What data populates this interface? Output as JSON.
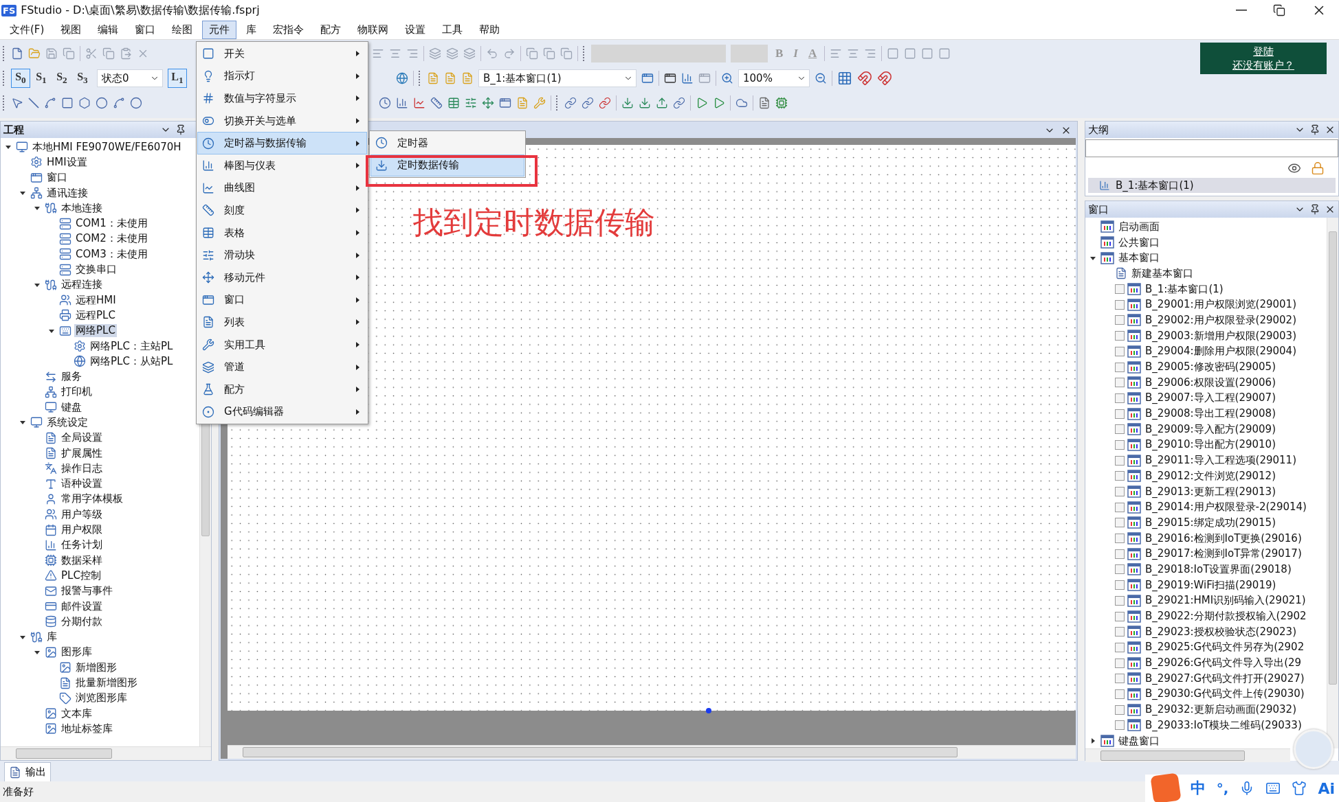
{
  "window": {
    "badge": "FS",
    "title": "FStudio - D:\\桌面\\繁易\\数据传输\\数据传输.fsprj"
  },
  "menu_bar": [
    {
      "label": "文件(F)",
      "selected": false
    },
    {
      "label": "视图",
      "selected": false
    },
    {
      "label": "编辑",
      "selected": false
    },
    {
      "label": "窗口",
      "selected": false
    },
    {
      "label": "绘图",
      "selected": false
    },
    {
      "label": "元件",
      "selected": true
    },
    {
      "label": "库",
      "selected": false
    },
    {
      "label": "宏指令",
      "selected": false
    },
    {
      "label": "配方",
      "selected": false
    },
    {
      "label": "物联网",
      "selected": false
    },
    {
      "label": "设置",
      "selected": false
    },
    {
      "label": "工具",
      "selected": false
    },
    {
      "label": "帮助",
      "selected": false
    }
  ],
  "toolbar": {
    "state_buttons": [
      {
        "label": "S$_{0}$",
        "selected": true
      },
      {
        "label": "S$_{1}$",
        "selected": false
      },
      {
        "label": "S$_{2}$",
        "selected": false
      },
      {
        "label": "S$_{3}$",
        "selected": false
      }
    ],
    "state_select": "状态0",
    "layer_button": "L$_{1}$",
    "window_select": "B_1:基本窗口(1)",
    "zoom_select": "100%",
    "format_buttons": [
      "B",
      "I",
      "A"
    ]
  },
  "login": {
    "title": "登陆",
    "subtitle": "还没有账户？"
  },
  "component_menu": {
    "items": [
      {
        "label": "开关",
        "selected": false
      },
      {
        "label": "指示灯",
        "selected": false
      },
      {
        "label": "数值与字符显示",
        "selected": false
      },
      {
        "label": "切换开关与选单",
        "selected": false
      },
      {
        "label": "定时器与数据传输",
        "selected": true
      },
      {
        "label": "棒图与仪表",
        "selected": false
      },
      {
        "label": "曲线图",
        "selected": false
      },
      {
        "label": "刻度",
        "selected": false
      },
      {
        "label": "表格",
        "selected": false
      },
      {
        "label": "滑动块",
        "selected": false
      },
      {
        "label": "移动元件",
        "selected": false
      },
      {
        "label": "窗口",
        "selected": false
      },
      {
        "label": "列表",
        "selected": false
      },
      {
        "label": "实用工具",
        "selected": false
      },
      {
        "label": "管道",
        "selected": false
      },
      {
        "label": "配方",
        "selected": false
      },
      {
        "label": "G代码编辑器",
        "selected": false
      }
    ],
    "submenu": [
      {
        "label": "定时器",
        "selected": false
      },
      {
        "label": "定时数据传输",
        "selected": true
      }
    ]
  },
  "annotation": "找到定时数据传输",
  "project_panel": {
    "title": "工程",
    "tree": [
      {
        "label": "本地HMI FE9070WE/FE6070H",
        "selected": false,
        "expanded": true,
        "children": [
          {
            "label": "HMI设置",
            "selected": false
          },
          {
            "label": "窗口",
            "selected": false
          },
          {
            "label": "通讯连接",
            "selected": false,
            "expanded": true,
            "children": [
              {
                "label": "本地连接",
                "selected": false,
                "expanded": true,
                "children": [
                  {
                    "label": "COM1：未使用",
                    "selected": false
                  },
                  {
                    "label": "COM2：未使用",
                    "selected": false
                  },
                  {
                    "label": "COM3：未使用",
                    "selected": false
                  },
                  {
                    "label": "交换串口",
                    "selected": false
                  }
                ]
              },
              {
                "label": "远程连接",
                "selected": false,
                "expanded": true,
                "children": [
                  {
                    "label": "远程HMI",
                    "selected": false
                  },
                  {
                    "label": "远程PLC",
                    "selected": false
                  },
                  {
                    "label": "网络PLC",
                    "selected": true,
                    "expanded": true,
                    "children": [
                      {
                        "label": "网络PLC：主站PL",
                        "selected": false
                      },
                      {
                        "label": "网络PLC：从站PL",
                        "selected": false
                      }
                    ]
                  }
                ]
              },
              {
                "label": "服务",
                "selected": false
              },
              {
                "label": "打印机",
                "selected": false
              },
              {
                "label": "键盘",
                "selected": false
              }
            ]
          },
          {
            "label": "系统设定",
            "selected": false,
            "expanded": true,
            "children": [
              {
                "label": "全局设置",
                "selected": false
              },
              {
                "label": "扩展属性",
                "selected": false
              },
              {
                "label": "操作日志",
                "selected": false
              },
              {
                "label": "语种设置",
                "selected": false
              },
              {
                "label": "常用字体模板",
                "selected": false
              },
              {
                "label": "用户等级",
                "selected": false
              },
              {
                "label": "用户权限",
                "selected": false
              },
              {
                "label": "任务计划",
                "selected": false
              },
              {
                "label": "数据采样",
                "selected": false
              },
              {
                "label": "PLC控制",
                "selected": false
              },
              {
                "label": "报警与事件",
                "selected": false
              },
              {
                "label": "邮件设置",
                "selected": false
              },
              {
                "label": "分期付款",
                "selected": false
              }
            ]
          },
          {
            "label": "库",
            "selected": false,
            "expanded": true,
            "children": [
              {
                "label": "图形库",
                "selected": false,
                "expanded": true,
                "children": [
                  {
                    "label": "新增图形",
                    "selected": false
                  },
                  {
                    "label": "批量新增图形",
                    "selected": false
                  },
                  {
                    "label": "浏览图形库",
                    "selected": false
                  }
                ]
              },
              {
                "label": "文本库",
                "selected": false
              },
              {
                "label": "地址标签库",
                "selected": false
              }
            ]
          }
        ]
      }
    ]
  },
  "outline_panel": {
    "title": "大纲",
    "row": "B_1:基本窗口(1)"
  },
  "window_panel": {
    "title": "窗口",
    "tree": [
      {
        "label": "启动画面",
        "kind": "folder"
      },
      {
        "label": "公共窗口",
        "kind": "folder"
      },
      {
        "label": "基本窗口",
        "kind": "folder",
        "expanded": true,
        "children": [
          {
            "label": "新建基本窗口",
            "kind": "action"
          },
          {
            "label": "B_1:基本窗口(1)",
            "kind": "page",
            "checked": false
          },
          {
            "label": "B_29001:用户权限浏览(29001)",
            "kind": "page",
            "checked": false
          },
          {
            "label": "B_29002:用户权限登录(29002)",
            "kind": "page",
            "checked": false
          },
          {
            "label": "B_29003:新增用户权限(29003)",
            "kind": "page",
            "checked": false
          },
          {
            "label": "B_29004:删除用户权限(29004)",
            "kind": "page",
            "checked": false
          },
          {
            "label": "B_29005:修改密码(29005)",
            "kind": "page",
            "checked": false
          },
          {
            "label": "B_29006:权限设置(29006)",
            "kind": "page",
            "checked": false
          },
          {
            "label": "B_29007:导入工程(29007)",
            "kind": "page",
            "checked": false
          },
          {
            "label": "B_29008:导出工程(29008)",
            "kind": "page",
            "checked": false
          },
          {
            "label": "B_29009:导入配方(29009)",
            "kind": "page",
            "checked": false
          },
          {
            "label": "B_29010:导出配方(29010)",
            "kind": "page",
            "checked": false
          },
          {
            "label": "B_29011:导入工程选项(29011)",
            "kind": "page",
            "checked": false
          },
          {
            "label": "B_29012:文件浏览(29012)",
            "kind": "page",
            "checked": false
          },
          {
            "label": "B_29013:更新工程(29013)",
            "kind": "page",
            "checked": false
          },
          {
            "label": "B_29014:用户权限登录-2(29014)",
            "kind": "page",
            "checked": false
          },
          {
            "label": "B_29015:绑定成功(29015)",
            "kind": "page",
            "checked": false
          },
          {
            "label": "B_29016:检测到IoT更换(29016)",
            "kind": "page",
            "checked": false
          },
          {
            "label": "B_29017:检测到IoT异常(29017)",
            "kind": "page",
            "checked": false
          },
          {
            "label": "B_29018:IoT设置界面(29018)",
            "kind": "page",
            "checked": false
          },
          {
            "label": "B_29019:WiFi扫描(29019)",
            "kind": "page",
            "checked": false
          },
          {
            "label": "B_29021:HMI识别码输入(29021)",
            "kind": "page",
            "checked": false
          },
          {
            "label": "B_29022:分期付款授权输入(2902",
            "kind": "page",
            "checked": false
          },
          {
            "label": "B_29023:授权校验状态(29023)",
            "kind": "page",
            "checked": false
          },
          {
            "label": "B_29025:G代码文件另存为(2902",
            "kind": "page",
            "checked": false
          },
          {
            "label": "B_29026:G代码文件导入导出(29",
            "kind": "page",
            "checked": false
          },
          {
            "label": "B_29027:G代码文件打开(29027)",
            "kind": "page",
            "checked": false
          },
          {
            "label": "B_29030:G代码文件上传(29030)",
            "kind": "page",
            "checked": false
          },
          {
            "label": "B_29032:更新启动画面(29032)",
            "kind": "page",
            "checked": false
          },
          {
            "label": "B_29033:IoT模块二维码(29033)",
            "kind": "page",
            "checked": false
          }
        ]
      },
      {
        "label": "键盘窗口",
        "kind": "folder",
        "expanded": false
      }
    ]
  },
  "output_tab": "输出",
  "status_bar": "准备好",
  "ime": {
    "mode": "中",
    "punct": "°,",
    "ai": "Ai"
  }
}
